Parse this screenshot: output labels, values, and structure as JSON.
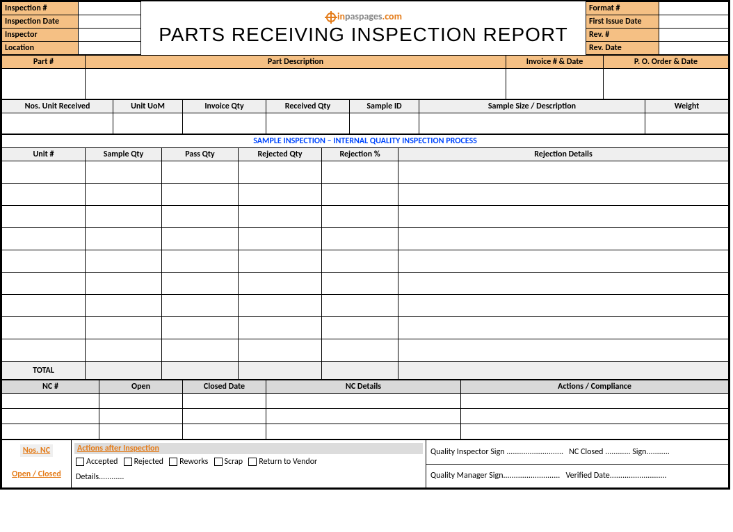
{
  "header": {
    "site": {
      "prefix": "in",
      "mid": "paspages",
      "suffix": ".com"
    },
    "title": "PARTS RECEIVING INSPECTION REPORT",
    "left_labels": [
      "Inspection #",
      "Inspection Date",
      "Inspector",
      "Location"
    ],
    "right_labels": [
      "Format #",
      "First Issue Date",
      "Rev. #",
      "Rev. Date"
    ]
  },
  "part_row": {
    "headers": [
      "Part #",
      "Part Description",
      "Invoice # & Date",
      "P. O. Order & Date"
    ]
  },
  "qty_row": {
    "headers": [
      "Nos. Unit Received",
      "Unit UoM",
      "Invoice Qty",
      "Received Qty",
      "Sample ID",
      "Sample Size / Description",
      "Weight"
    ]
  },
  "sample_section": {
    "title": "SAMPLE INSPECTION – INTERNAL QUALITY INSPECTION PROCESS",
    "headers": [
      "Unit #",
      "Sample Qty",
      "Pass Qty",
      "Rejected Qty",
      "Rejection %",
      "Rejection Details"
    ],
    "total": "TOTAL"
  },
  "nc_section": {
    "headers": [
      "NC #",
      "Open",
      "Closed Date",
      "NC Details",
      "Actions / Compliance"
    ]
  },
  "footer": {
    "nos_nc": "Nos. NC",
    "open_closed": "Open / Closed",
    "actions_title": "Actions after Inspection",
    "options": [
      "Accepted",
      "Rejected",
      "Reworks",
      "Scrap",
      "Return to Vendor"
    ],
    "details": "Details............",
    "qi_sign": "Quality Inspector Sign ...........................",
    "nc_closed": "NC Closed ............ Sign...........",
    "qm_sign": "Quality Manager Sign...........................",
    "verified": "Verified Date..........................."
  }
}
